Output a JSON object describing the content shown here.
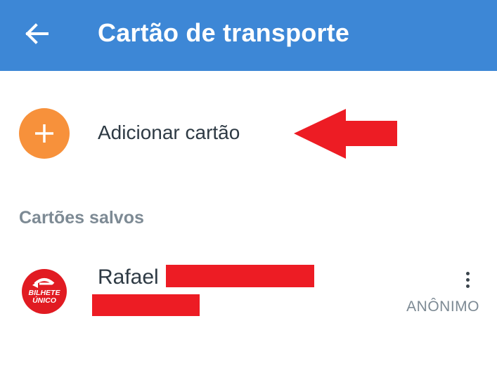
{
  "appbar": {
    "title": "Cartão de transporte",
    "back_icon": "arrow-left-icon",
    "background": "#3d87d6"
  },
  "add_card": {
    "label": "Adicionar cartão",
    "icon": "plus-icon",
    "accent": "#f7913b"
  },
  "annotation": {
    "icon": "red-arrow-left-icon",
    "color": "#ed1c24"
  },
  "saved": {
    "header": "Cartões salvos",
    "cards": [
      {
        "name": "Rafael",
        "type": "ANÔNIMO",
        "logo_line1": "BILHETE",
        "logo_line2": "ÚNICO",
        "logo_icon": "bilhete-unico-logo",
        "menu_icon": "more-vertical-icon"
      }
    ]
  }
}
